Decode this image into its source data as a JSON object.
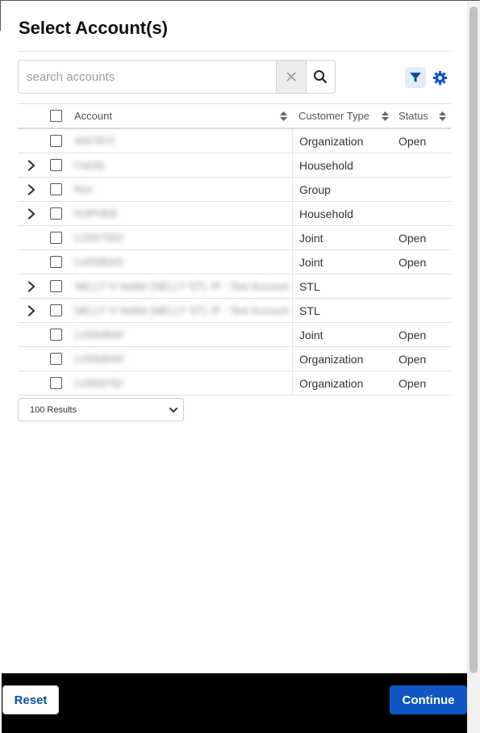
{
  "dialog": {
    "title": "Select Account(s)"
  },
  "search": {
    "placeholder": "search accounts",
    "value": ""
  },
  "icons": {
    "clear": "close-icon",
    "search": "search-icon",
    "filter": "filter-icon",
    "settings": "gear-icon",
    "expand": "chevron-right-icon"
  },
  "colors": {
    "accent": "#1057c6",
    "filter_bg": "#e3ecf6",
    "footer": "#000000"
  },
  "table": {
    "columns": {
      "account": "Account",
      "customer_type": "Customer Type",
      "status": "Status"
    },
    "rows": [
      {
        "expandable": false,
        "account": "4007872",
        "customer_type": "Organization",
        "status": "Open"
      },
      {
        "expandable": true,
        "account": "Family",
        "customer_type": "Household",
        "status": ""
      },
      {
        "expandable": true,
        "account": "Rex",
        "customer_type": "Group",
        "status": ""
      },
      {
        "expandable": true,
        "account": "KHPHEB",
        "customer_type": "Household",
        "status": ""
      },
      {
        "expandable": false,
        "account": "LO557952",
        "customer_type": "Joint",
        "status": "Open"
      },
      {
        "expandable": false,
        "account": "LH558043",
        "customer_type": "Joint",
        "status": "Open"
      },
      {
        "expandable": true,
        "account": "NELLY H Noble (NELLY STL IP - Test Account",
        "customer_type": "STL",
        "status": ""
      },
      {
        "expandable": true,
        "account": "NELLY H Noble (NELLY STL IP - Test Account",
        "customer_type": "STL",
        "status": ""
      },
      {
        "expandable": false,
        "account": "LO563849",
        "customer_type": "Joint",
        "status": "Open"
      },
      {
        "expandable": false,
        "account": "LO563049",
        "customer_type": "Organization",
        "status": "Open"
      },
      {
        "expandable": false,
        "account": "LO563762",
        "customer_type": "Organization",
        "status": "Open"
      }
    ]
  },
  "pagination": {
    "results_selected": "100 Results"
  },
  "footer": {
    "reset_label": "Reset",
    "continue_label": "Continue"
  }
}
